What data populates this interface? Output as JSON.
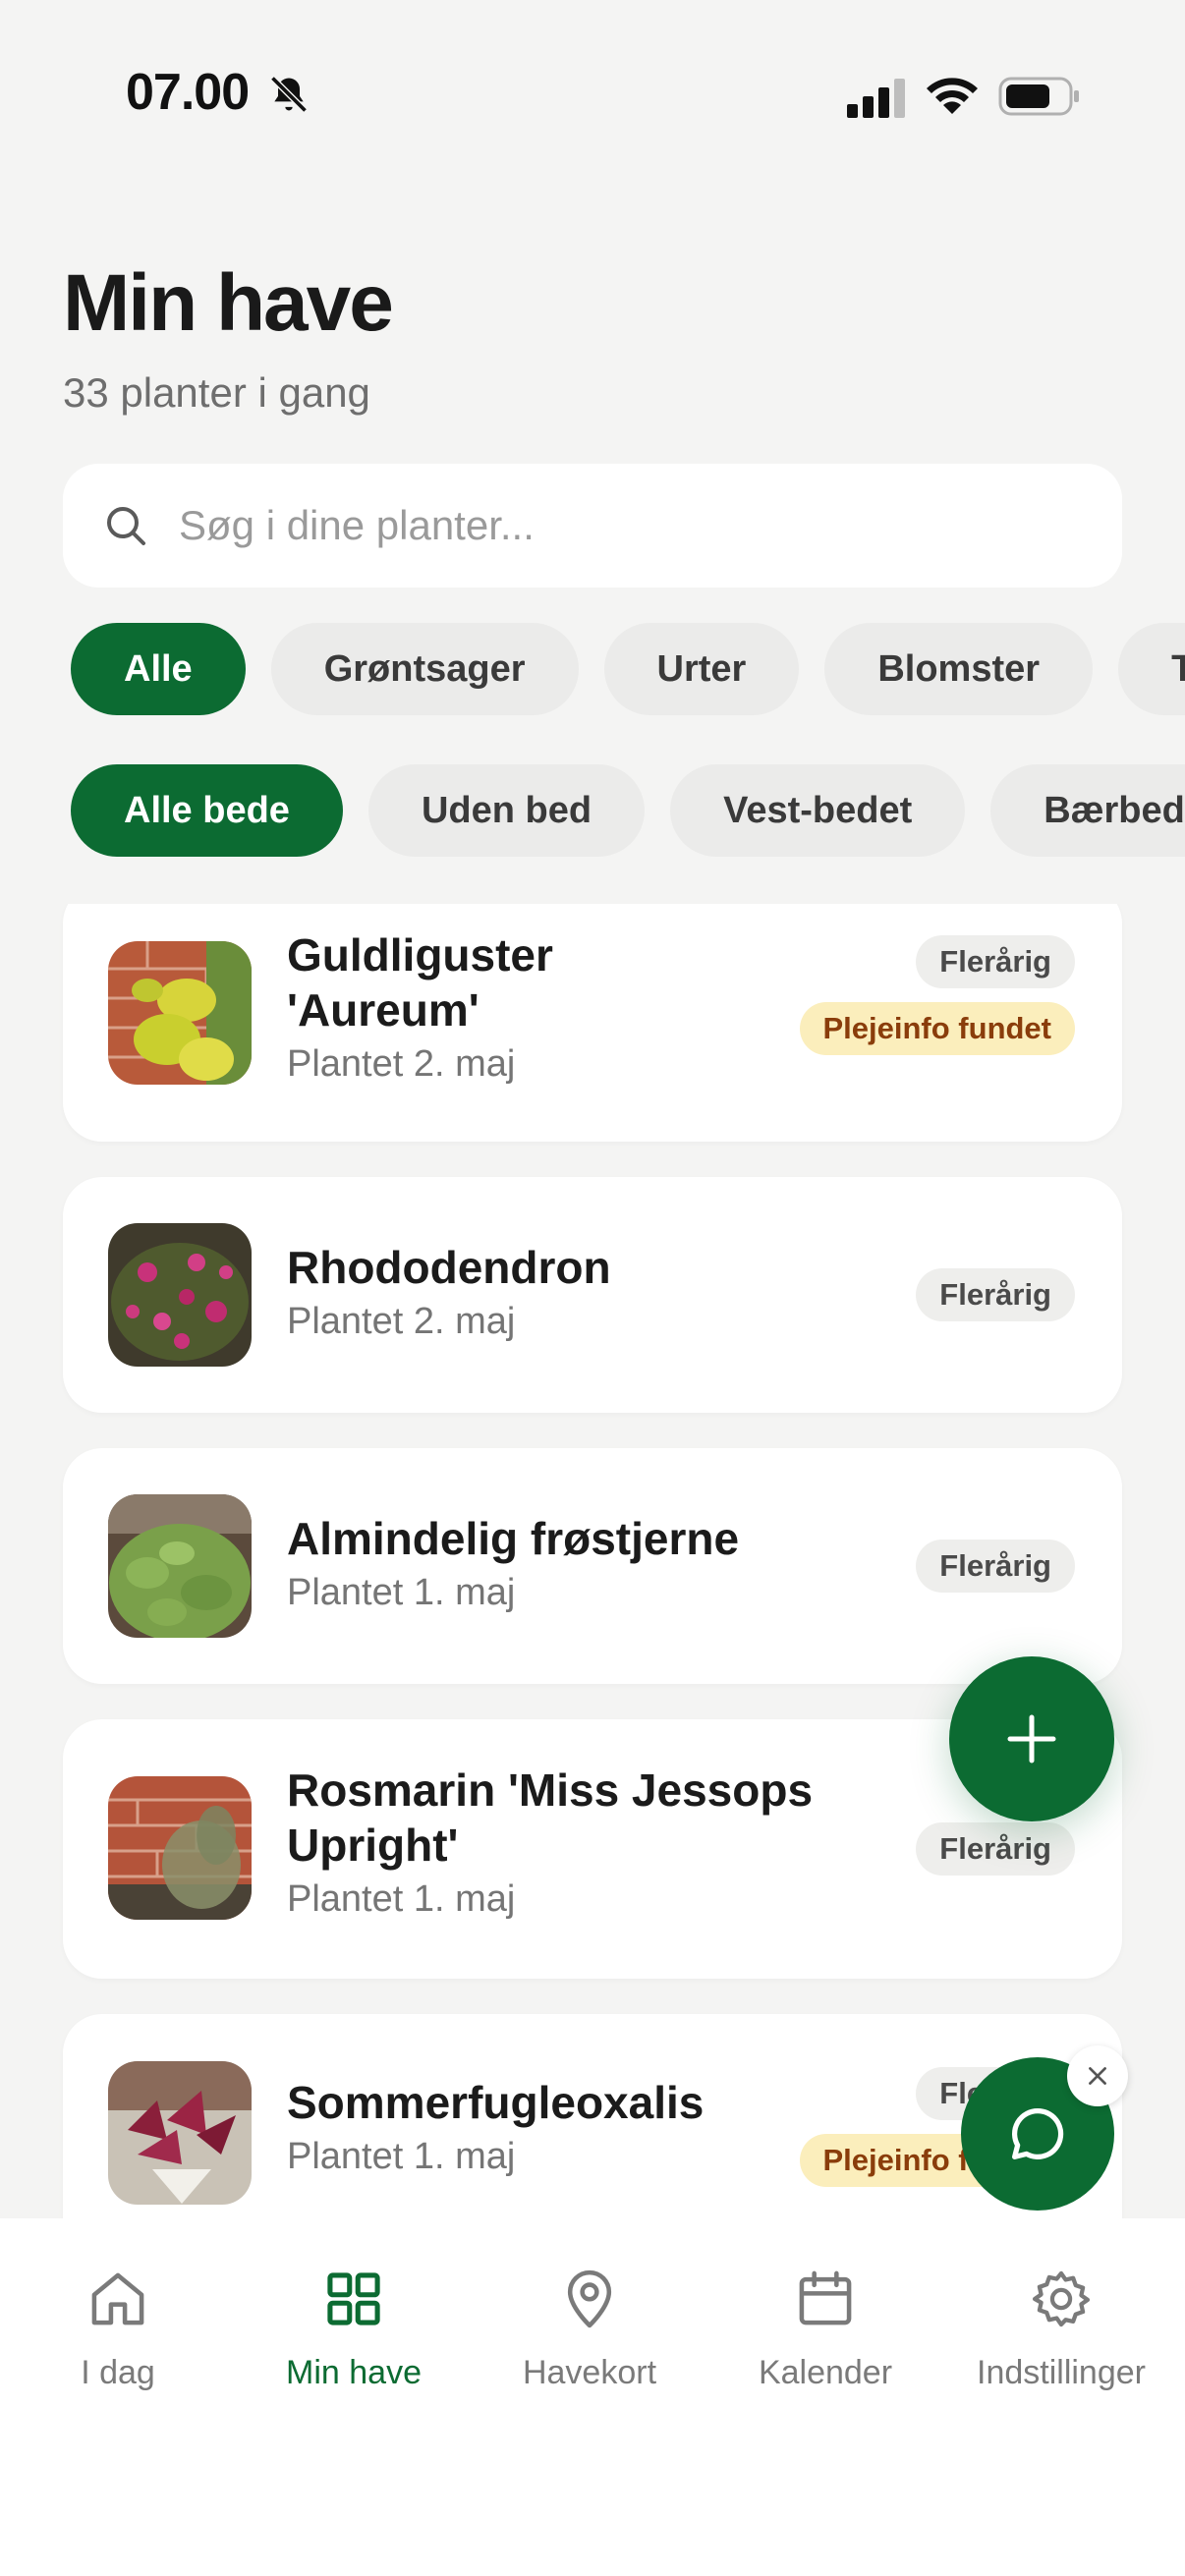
{
  "status_bar": {
    "time": "07.00"
  },
  "header": {
    "title": "Min have",
    "subtitle": "33 planter i gang"
  },
  "search": {
    "placeholder": "Søg i dine planter..."
  },
  "category_filters": [
    {
      "label": "Alle",
      "selected": true
    },
    {
      "label": "Grøntsager",
      "selected": false
    },
    {
      "label": "Urter",
      "selected": false
    },
    {
      "label": "Blomster",
      "selected": false
    },
    {
      "label": "Træer",
      "selected": false
    }
  ],
  "bed_filters": [
    {
      "label": "Alle bede",
      "selected": true
    },
    {
      "label": "Uden bed",
      "selected": false
    },
    {
      "label": "Vest-bedet",
      "selected": false
    },
    {
      "label": "Bærbedet",
      "selected": false
    }
  ],
  "plants": [
    {
      "name_line1": "Guldliguster",
      "name_line2": "'Aureum'",
      "date": "Plantet 2. maj",
      "tag": "Flerårig",
      "care_tag": "Plejeinfo fundet"
    },
    {
      "name_line1": "Rhododendron",
      "date": "Plantet 2. maj",
      "tag": "Flerårig"
    },
    {
      "name_line1": "Almindelig frøstjerne",
      "date": "Plantet 1. maj",
      "tag": "Flerårig"
    },
    {
      "name_line1": "Rosmarin 'Miss Jessops",
      "name_line2": "Upright'",
      "date": "Plantet 1. maj",
      "tag": "Flerårig"
    },
    {
      "name_line1": "Sommerfugleoxalis",
      "date": "Plantet 1. maj",
      "tag": "Flerårig",
      "care_tag": "Plejeinfo fundet"
    }
  ],
  "tab_bar": {
    "items": [
      {
        "label": "I dag",
        "icon": "home-icon"
      },
      {
        "label": "Min have",
        "icon": "grid-icon",
        "active": true
      },
      {
        "label": "Havekort",
        "icon": "map-pin-icon"
      },
      {
        "label": "Kalender",
        "icon": "calendar-icon"
      },
      {
        "label": "Indstillinger",
        "icon": "gear-icon"
      }
    ]
  },
  "colors": {
    "accent": "#0c6b32",
    "background": "#f4f4f3",
    "care_tag_bg": "#fbeebc",
    "care_tag_text": "#8a3d0b"
  }
}
